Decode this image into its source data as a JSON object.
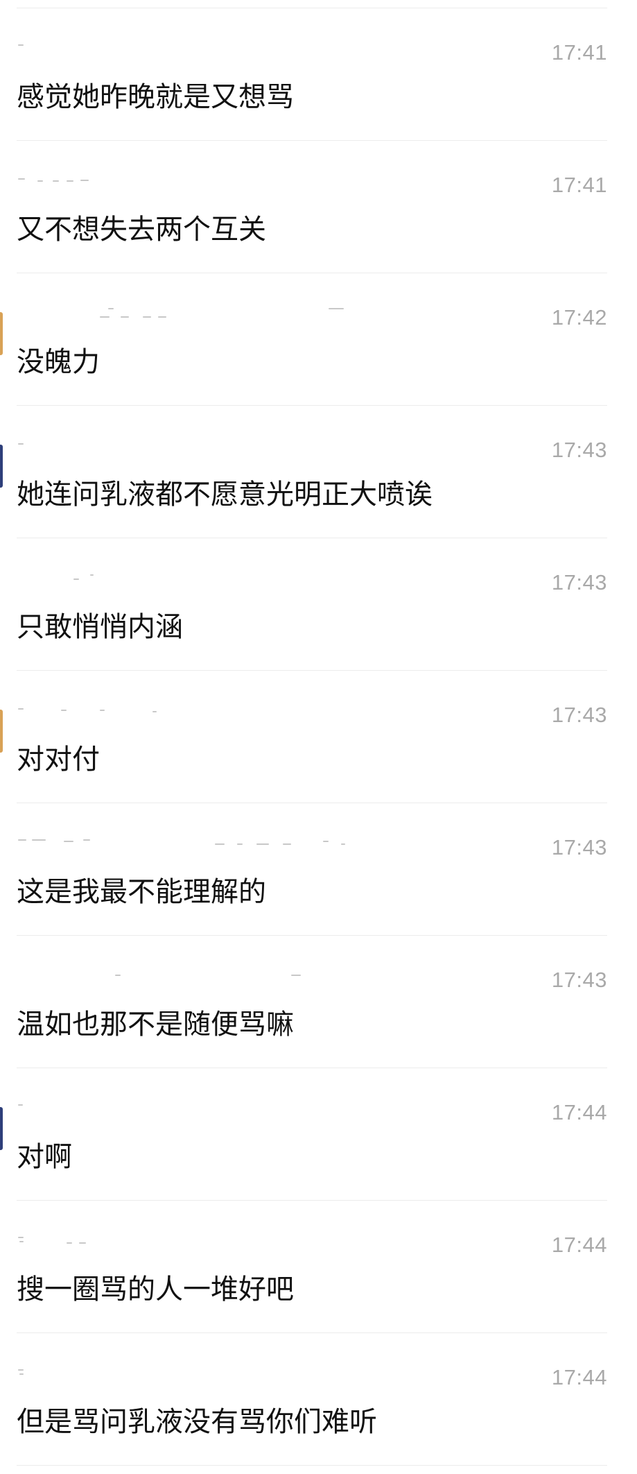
{
  "messages": [
    {
      "time": "17:41",
      "text": "感觉她昨晚就是又想骂",
      "avatar": null
    },
    {
      "time": "17:41",
      "text": "又不想失去两个互关",
      "avatar": null
    },
    {
      "time": "17:42",
      "text": "没魄力",
      "avatar": "#d9a256"
    },
    {
      "time": "17:43",
      "text": "她连问乳液都不愿意光明正大喷诶",
      "avatar": "#2e3f7a"
    },
    {
      "time": "17:43",
      "text": "只敢悄悄内涵",
      "avatar": null
    },
    {
      "time": "17:43",
      "text": "对对付",
      "avatar": "#d9a256"
    },
    {
      "time": "17:43",
      "text": "这是我最不能理解的",
      "avatar": null
    },
    {
      "time": "17:43",
      "text": "温如也那不是随便骂嘛",
      "avatar": null
    },
    {
      "time": "17:44",
      "text": "对啊",
      "avatar": "#2e3f7a"
    },
    {
      "time": "17:44",
      "text": "搜一圈骂的人一堆好吧",
      "avatar": null
    },
    {
      "time": "17:44",
      "text": "但是骂问乳液没有骂你们难听",
      "avatar": null
    }
  ]
}
